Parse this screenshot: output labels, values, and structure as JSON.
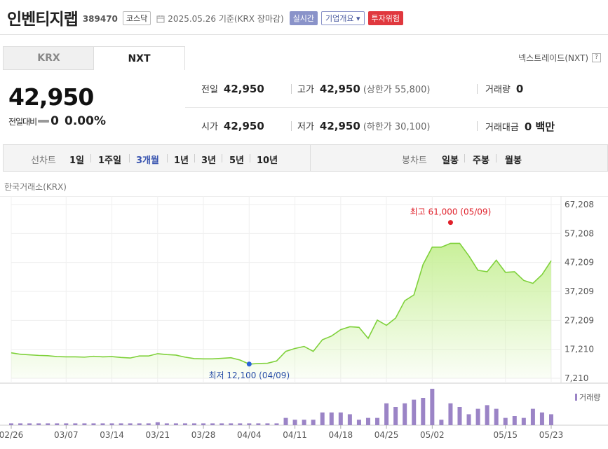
{
  "header": {
    "name": "인벤티지랩",
    "code": "389470",
    "market": "코스닥",
    "date": "2025.05.26 기준(KRX 장마감)",
    "realtime": "실시간",
    "company": "기업개요 ▾",
    "risk": "투자위험"
  },
  "tabs": {
    "krx": "KRX",
    "nxt": "NXT"
  },
  "nextrade": "넥스트레이드(NXT)",
  "help": "?",
  "price": {
    "current": "42,950",
    "change_label": "전일대비",
    "change": "0",
    "change_pct": "0.00%"
  },
  "info": {
    "prev_label": "전일",
    "prev": "42,950",
    "high_label": "고가",
    "high": "42,950",
    "upper_limit": "(상한가 55,800)",
    "volume_label": "거래량",
    "volume": "0",
    "open_label": "시가",
    "open": "42,950",
    "low_label": "저가",
    "low": "42,950",
    "lower_limit": "(하한가 30,100)",
    "amount_label": "거래대금",
    "amount": "0 백만"
  },
  "periods": {
    "line_label": "선차트",
    "line_options": [
      "1일",
      "1주일",
      "3개월",
      "1년",
      "3년",
      "5년",
      "10년"
    ],
    "active": "3개월",
    "candle_label": "봉차트",
    "candle_options": [
      "일봉",
      "주봉",
      "월봉"
    ]
  },
  "source": "한국거래소(KRX)",
  "colors": {
    "area_fill": "#c9f09a",
    "line": "#7fd13b",
    "volume": "#9b84c6",
    "high_marker": "#e0202a",
    "low_marker": "#2a62d8"
  },
  "chart_data": {
    "type": "area",
    "y_ticks": [
      "67,208",
      "57,208",
      "47,209",
      "37,209",
      "27,209",
      "17,210",
      "7,210"
    ],
    "y_tick_values": [
      67208,
      57208,
      47209,
      37209,
      27209,
      17210,
      7210
    ],
    "ylim": [
      7210,
      67208
    ],
    "x_tick_labels": [
      "02/26",
      "03/07",
      "03/14",
      "03/21",
      "03/28",
      "04/04",
      "04/11",
      "04/18",
      "04/25",
      "05/02",
      "05/15",
      "05/23"
    ],
    "x_tick_index": [
      0,
      6,
      11,
      16,
      21,
      26,
      31,
      36,
      41,
      46,
      54,
      59
    ],
    "price": [
      16000,
      15500,
      15300,
      15100,
      15000,
      14700,
      14600,
      14600,
      14500,
      14800,
      14600,
      14700,
      14400,
      14200,
      14900,
      14900,
      15700,
      15400,
      15200,
      14500,
      14000,
      13900,
      13900,
      14100,
      14300,
      13500,
      12100,
      12300,
      12400,
      13200,
      16500,
      17500,
      18200,
      16500,
      20500,
      21800,
      24000,
      25000,
      24800,
      21000,
      27300,
      25500,
      28000,
      34000,
      36000,
      46500,
      52500,
      52500,
      53800,
      53800,
      49500,
      44500,
      44000,
      48000,
      43800,
      44000,
      41000,
      40000,
      43000,
      47800
    ],
    "volume": [
      0.05,
      0.05,
      0.05,
      0.05,
      0.05,
      0.05,
      0.05,
      0.05,
      0.05,
      0.05,
      0.05,
      0.05,
      0.05,
      0.05,
      0.05,
      0.05,
      0.08,
      0.05,
      0.05,
      0.05,
      0.05,
      0.05,
      0.05,
      0.05,
      0.05,
      0.05,
      0.05,
      0.05,
      0.05,
      0.05,
      0.2,
      0.15,
      0.15,
      0.15,
      0.35,
      0.35,
      0.35,
      0.3,
      0.15,
      0.2,
      0.2,
      0.6,
      0.5,
      0.6,
      0.7,
      0.75,
      1.0,
      0.15,
      0.6,
      0.5,
      0.3,
      0.45,
      0.55,
      0.45,
      0.2,
      0.25,
      0.2,
      0.45,
      0.35,
      0.3
    ],
    "high": {
      "label": "최고 61,000 (05/09)",
      "value": 61000
    },
    "low": {
      "label": "최저 12,100 (04/09)",
      "value": 12100
    },
    "volume_legend": "거래량"
  }
}
